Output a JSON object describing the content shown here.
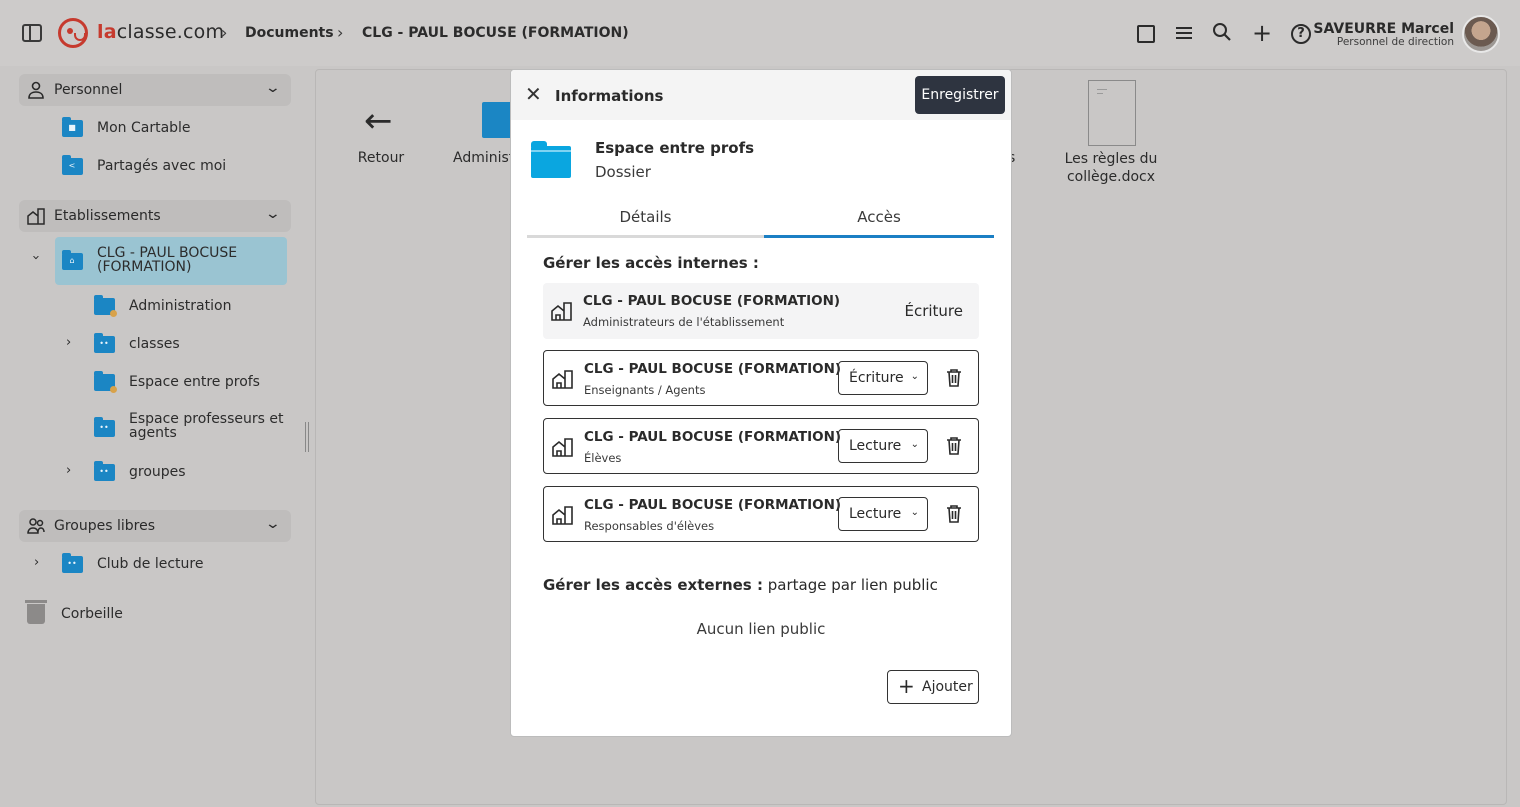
{
  "header": {
    "brand_prefix": "la",
    "brand_suffix": "classe.com",
    "breadcrumb": [
      "Documents",
      "CLG - PAUL BOCUSE (FORMATION)"
    ],
    "user": {
      "name": "SAVEURRE Marcel",
      "role": "Personnel de direction"
    },
    "icons": [
      "sidebar-toggle-icon",
      "square-view-icon",
      "list-view-icon",
      "search-icon",
      "plus-icon",
      "help-icon"
    ]
  },
  "sidebar": {
    "personnel": {
      "label": "Personnel",
      "items": [
        {
          "label": "Mon Cartable"
        },
        {
          "label": "Partagés avec moi"
        }
      ]
    },
    "etablissements": {
      "label": "Etablissements",
      "active": "CLG - PAUL BOCUSE (FORMATION)",
      "items": [
        {
          "label": "Administration"
        },
        {
          "label": "classes"
        },
        {
          "label": "Espace entre profs"
        },
        {
          "label": "Espace professeurs et agents"
        },
        {
          "label": "groupes"
        }
      ]
    },
    "groupes": {
      "label": "Groupes libres",
      "items": [
        {
          "label": "Club de lecture"
        }
      ]
    },
    "trash": "Corbeille"
  },
  "content": {
    "back_label": "Retour",
    "items": [
      "Administ",
      "s",
      "Les règles du collège.docx"
    ]
  },
  "modal": {
    "title": "Informations",
    "save_label": "Enregistrer",
    "item_name": "Espace entre profs",
    "item_type": "Dossier",
    "tabs": [
      "Détails",
      "Accès"
    ],
    "active_tab": "Accès",
    "internal_title": "Gérer les accès internes :",
    "access": [
      {
        "name": "CLG - PAUL BOCUSE (FORMATION)",
        "sub": "Administrateurs de l'établissement",
        "right": "Écriture",
        "editable": false
      },
      {
        "name": "CLG - PAUL BOCUSE (FORMATION)",
        "sub": "Enseignants / Agents",
        "right": "Écriture",
        "editable": true
      },
      {
        "name": "CLG - PAUL BOCUSE (FORMATION)",
        "sub": "Élèves",
        "right": "Lecture",
        "editable": true
      },
      {
        "name": "CLG - PAUL BOCUSE (FORMATION)",
        "sub": "Responsables d'élèves",
        "right": "Lecture",
        "editable": true
      }
    ],
    "external_title_bold": "Gérer les accès externes :",
    "external_title_rest": " partage par lien public",
    "no_link": "Aucun lien public",
    "add_label": "Ajouter"
  },
  "colors": {
    "brand": "#c63a2e",
    "accent": "#1b7fc4",
    "folder": "#1b86c4",
    "active_bg": "#9ac4d2",
    "dark_button": "#2e3440"
  }
}
